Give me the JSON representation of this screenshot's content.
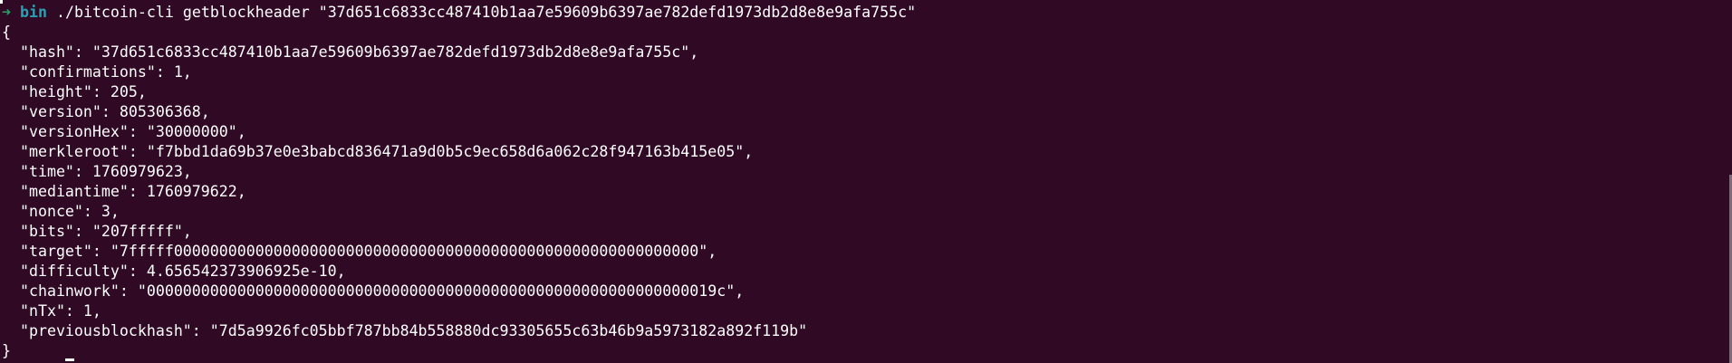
{
  "terminal": {
    "prompt": {
      "arrow": "➜",
      "directory": "bin",
      "command": "./bitcoin-cli getblockheader \"37d651c6833cc487410b1aa7e59609b6397ae782defd1973db2d8e8e9afa755c\""
    },
    "output_lines": [
      "{",
      "  \"hash\": \"37d651c6833cc487410b1aa7e59609b6397ae782defd1973db2d8e8e9afa755c\",",
      "  \"confirmations\": 1,",
      "  \"height\": 205,",
      "  \"version\": 805306368,",
      "  \"versionHex\": \"30000000\",",
      "  \"merkleroot\": \"f7bbd1da69b37e0e3babcd836471a9d0b5c9ec658d6a062c28f947163b415e05\",",
      "  \"time\": 1760979623,",
      "  \"mediantime\": 1760979622,",
      "  \"nonce\": 3,",
      "  \"bits\": \"207fffff\",",
      "  \"target\": \"7fffff0000000000000000000000000000000000000000000000000000000000\",",
      "  \"difficulty\": 4.656542373906925e-10,",
      "  \"chainwork\": \"000000000000000000000000000000000000000000000000000000000000019c\",",
      "  \"nTx\": 1,",
      "  \"previousblockhash\": \"7d5a9926fc05bbf787bb84b558880dc93305655c63b46b9a5973182a892f119b\"",
      "}"
    ]
  }
}
